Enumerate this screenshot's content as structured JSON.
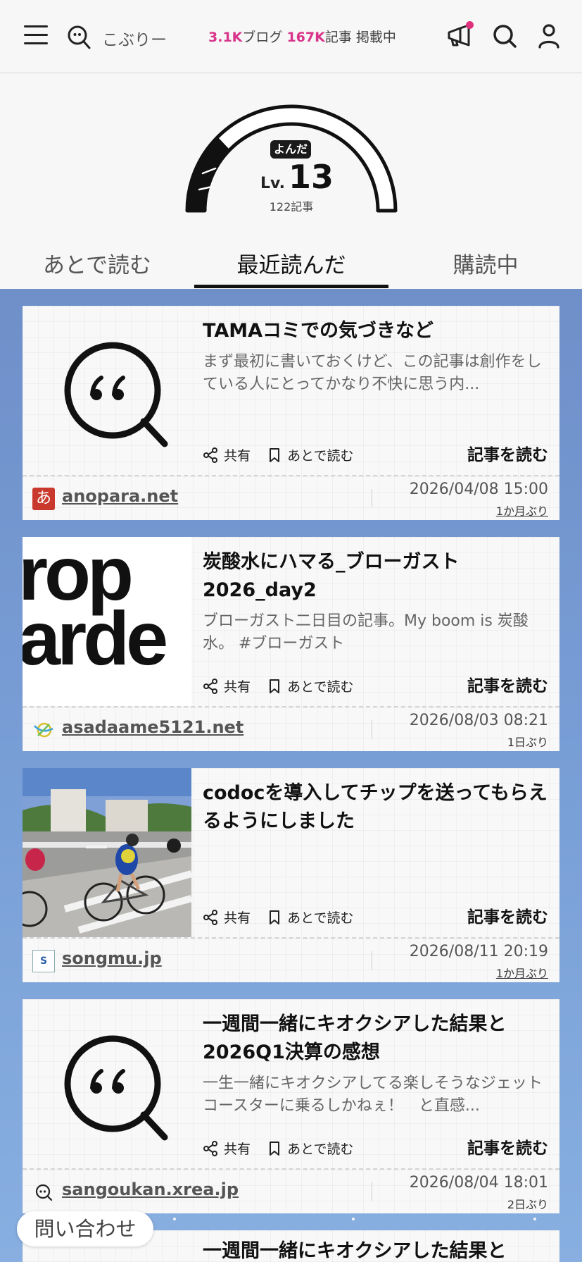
{
  "header": {
    "site_name": "こぶりー",
    "stats": {
      "blogs_count": "3.1K",
      "blogs_label": "ブログ",
      "articles_count": "167K",
      "articles_label": "記事 掲載中"
    }
  },
  "gauge": {
    "badge": "よんだ",
    "level_prefix": "Lv.",
    "level": "13",
    "read_count": "122記事",
    "progress_fraction": 0.3
  },
  "tabs": [
    {
      "label": "あとで読む",
      "active": false
    },
    {
      "label": "最近読んだ",
      "active": true
    },
    {
      "label": "購読中",
      "active": false
    }
  ],
  "actions": {
    "share": "共有",
    "later": "あとで読む",
    "read": "記事を読む"
  },
  "articles": [
    {
      "title": "TAMAコミでの気づきなど",
      "desc": "まず最初に書いておくけど、この記事は創作をしている人にとってかなり不快に思う内...",
      "domain": "anopara.net",
      "date": "2026/04/08 15:00",
      "ago": "1か月ぶり",
      "thumb": "placeholder",
      "favicon_char": "あ"
    },
    {
      "title": "炭酸水にハマる_ブローガスト2026_day2",
      "desc": "ブローガスト二日目の記事。My boom is 炭酸水。 #ブローガスト",
      "domain": "asadaame5121.net",
      "date": "2026/08/03 08:21",
      "ago": "1日ぶり",
      "thumb": "text",
      "thumb_text": [
        "rop",
        "arde"
      ]
    },
    {
      "title": "codocを導入してチップを送ってもらえるようにしました",
      "desc": "",
      "domain": "songmu.jp",
      "date": "2026/08/11 20:19",
      "ago": "1か月ぶり",
      "thumb": "photo",
      "favicon_char": "S"
    },
    {
      "title": "一週間一緒にキオクシアした結果と2026Q1決算の感想",
      "desc": "一生一緒にキオクシアしてる楽しそうなジェットコースターに乗るしかねぇ！　と直感...",
      "domain": "sangoukan.xrea.jp",
      "date": "2026/08/04 18:01",
      "ago": "2日ぶり",
      "thumb": "placeholder"
    },
    {
      "title": "一週間一緒にキオクシアした結果と"
    }
  ],
  "contact_label": "問い合わせ",
  "colors": {
    "accent": "#d8348a",
    "feed_bg": "#7aa0d8",
    "notify": "#e0317f"
  }
}
